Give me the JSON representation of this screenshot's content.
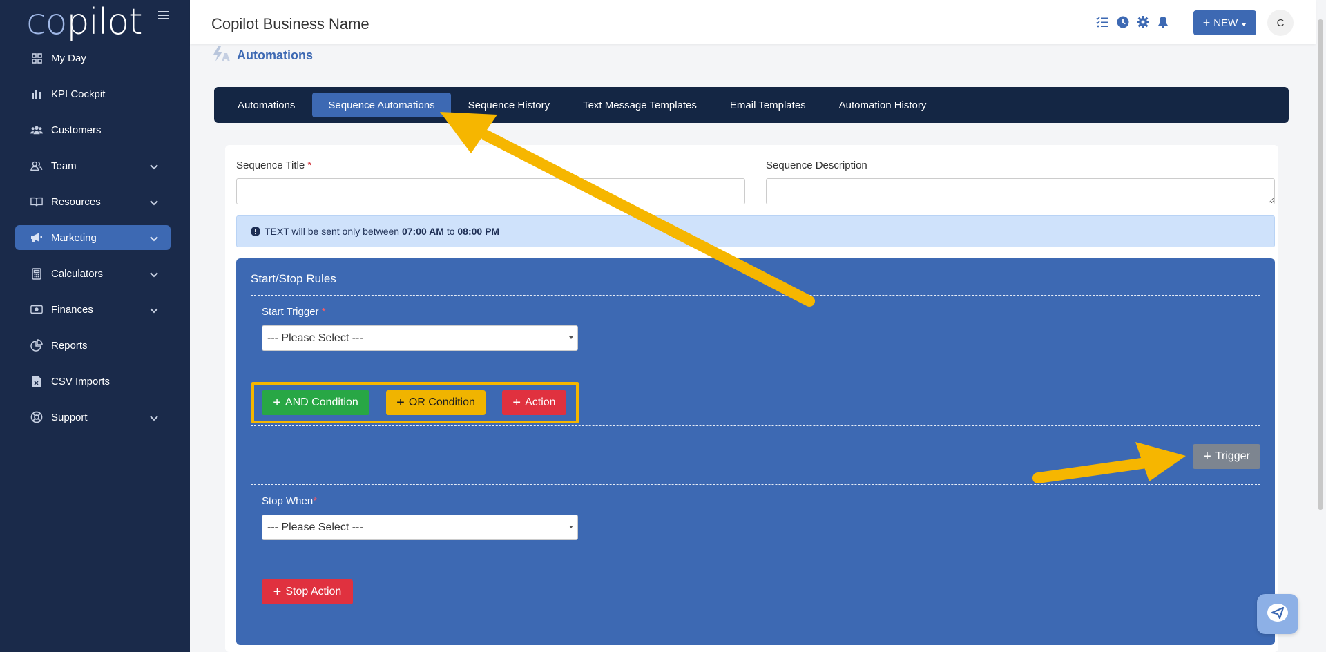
{
  "app": {
    "logo_prefix": "co",
    "logo_suffix": "pilot"
  },
  "sidebar": {
    "items": [
      {
        "label": "My Day",
        "icon": "grid-icon",
        "chevron": false,
        "active": false
      },
      {
        "label": "KPI Cockpit",
        "icon": "bar-chart-icon",
        "chevron": false,
        "active": false
      },
      {
        "label": "Customers",
        "icon": "users-icon",
        "chevron": false,
        "active": false
      },
      {
        "label": "Team",
        "icon": "user-group-icon",
        "chevron": true,
        "active": false
      },
      {
        "label": "Resources",
        "icon": "book-icon",
        "chevron": true,
        "active": false
      },
      {
        "label": "Marketing",
        "icon": "megaphone-icon",
        "chevron": true,
        "active": true
      },
      {
        "label": "Calculators",
        "icon": "calculator-icon",
        "chevron": true,
        "active": false
      },
      {
        "label": "Finances",
        "icon": "money-icon",
        "chevron": true,
        "active": false
      },
      {
        "label": "Reports",
        "icon": "pie-chart-icon",
        "chevron": false,
        "active": false
      },
      {
        "label": "CSV Imports",
        "icon": "file-csv-icon",
        "chevron": false,
        "active": false
      },
      {
        "label": "Support",
        "icon": "lifebuoy-icon",
        "chevron": true,
        "active": false
      }
    ]
  },
  "header": {
    "business_name": "Copilot Business Name",
    "new_button": "NEW",
    "avatar_initial": "C"
  },
  "page": {
    "title": "Automations"
  },
  "tabs": [
    {
      "label": "Automations",
      "active": false
    },
    {
      "label": "Sequence Automations",
      "active": true
    },
    {
      "label": "Sequence History",
      "active": false
    },
    {
      "label": "Text Message Templates",
      "active": false
    },
    {
      "label": "Email Templates",
      "active": false
    },
    {
      "label": "Automation History",
      "active": false
    }
  ],
  "form": {
    "title_label": "Sequence Title",
    "title_value": "",
    "description_label": "Sequence Description",
    "description_value": "",
    "required_mark": "*"
  },
  "info": {
    "prefix": "TEXT will be sent only between",
    "start_time": "07:00 AM",
    "joiner": "to",
    "end_time": "08:00 PM"
  },
  "rules": {
    "title": "Start/Stop Rules",
    "start_trigger_label": "Start Trigger",
    "start_trigger_value": "--- Please Select ---",
    "and_condition": "AND Condition",
    "or_condition": "OR Condition",
    "action": "Action",
    "trigger_button": "Trigger",
    "stop_when_label": "Stop When",
    "stop_when_value": "--- Please Select ---",
    "stop_action": "Stop Action"
  },
  "colors": {
    "sidebar_bg": "#1a2a4a",
    "accent": "#3d69b3",
    "annotation_arrow": "#f6b600"
  }
}
